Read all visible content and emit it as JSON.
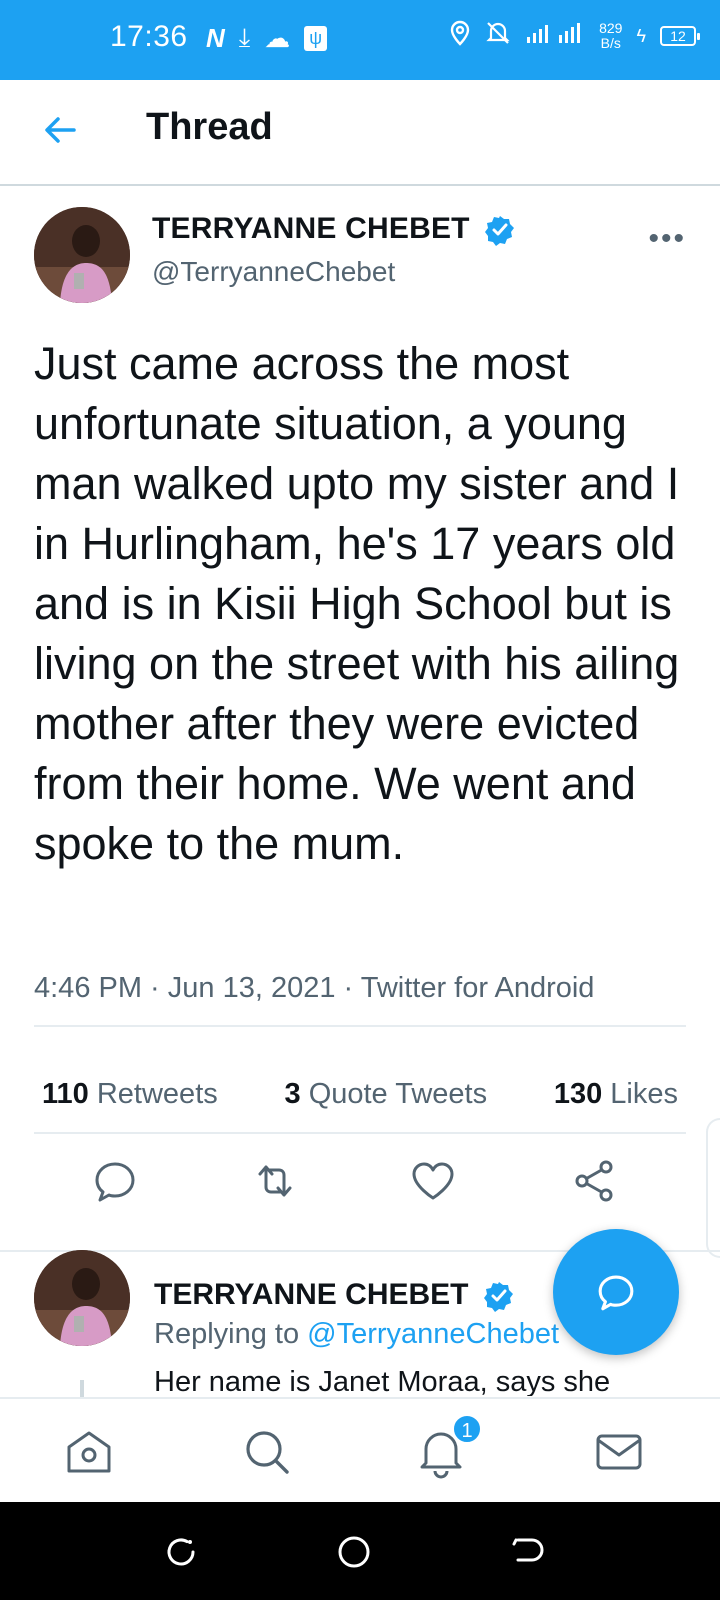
{
  "status_bar": {
    "time": "17:36",
    "speed_value": "829",
    "speed_unit": "B/s",
    "battery": "12"
  },
  "header": {
    "title": "Thread"
  },
  "tweet": {
    "author_name": "TERRYANNE CHEBET",
    "handle": "@TerryanneChebet",
    "text": "Just came across the most unfortunate situation, a young man walked upto my sister and I in Hurlingham, he's 17 years old and is in Kisii High School but is living on the street with his ailing mother after they were evicted from their home. We went and spoke to the mum.",
    "meta": "4:46 PM · Jun 13, 2021 · Twitter for Android",
    "retweets_count": "110",
    "retweets_label": "Retweets",
    "quotes_count": "3",
    "quotes_label": "Quote Tweets",
    "likes_count": "130",
    "likes_label": "Likes"
  },
  "reply": {
    "author_name": "TERRYANNE CHEBET",
    "replying_prefix": "Replying to ",
    "replying_handle": "@TerryanneChebet",
    "snippet": "Her name is Janet Moraa, says she"
  },
  "bottom_nav": {
    "notifications_badge": "1"
  },
  "colors": {
    "accent": "#1da1f2",
    "text": "#0f1419",
    "secondary": "#536471"
  }
}
